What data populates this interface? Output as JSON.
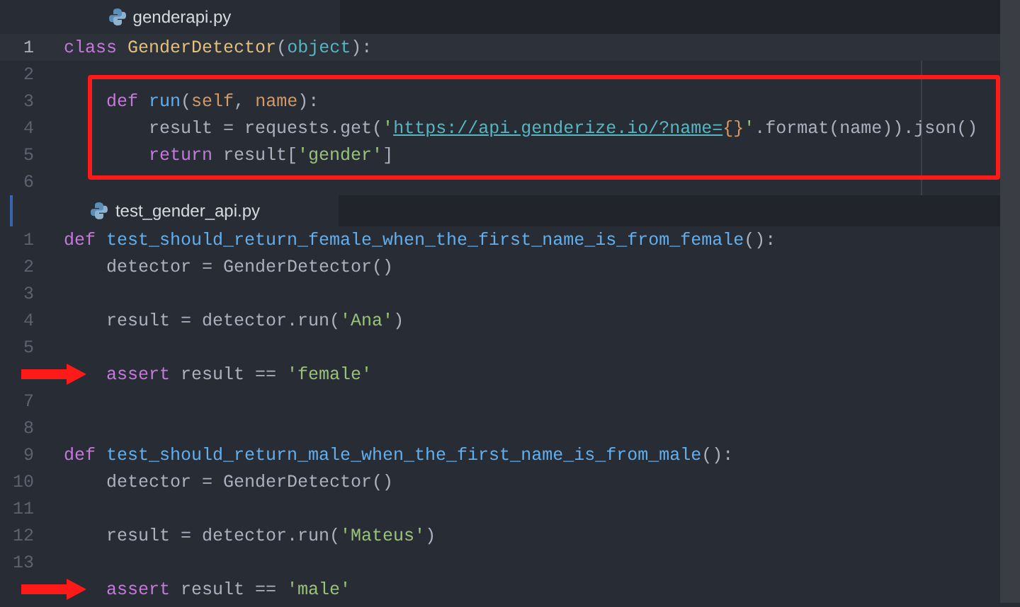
{
  "panes": [
    {
      "tab": {
        "filename": "genderapi.py"
      },
      "lines": [
        {
          "number": "1",
          "active": true,
          "tokens": [
            {
              "kind": "keyword",
              "text": "class "
            },
            {
              "kind": "class",
              "text": "GenderDetector"
            },
            {
              "kind": "plain",
              "text": "("
            },
            {
              "kind": "builtin",
              "text": "object"
            },
            {
              "kind": "plain",
              "text": "):"
            }
          ]
        },
        {
          "number": "2",
          "active": false
        },
        {
          "number": "3",
          "active": false,
          "boxed": true,
          "tokens": [
            {
              "kind": "keyword",
              "text": "    def "
            },
            {
              "kind": "function",
              "text": "run"
            },
            {
              "kind": "plain",
              "text": "("
            },
            {
              "kind": "param",
              "text": "self"
            },
            {
              "kind": "plain",
              "text": ", "
            },
            {
              "kind": "param",
              "text": "name"
            },
            {
              "kind": "plain",
              "text": "):"
            }
          ]
        },
        {
          "number": "4",
          "active": false,
          "boxed": true,
          "tokens": [
            {
              "kind": "plain",
              "text": "        result = requests.get("
            },
            {
              "kind": "string",
              "text": "'"
            },
            {
              "kind": "url",
              "text": "https://api.genderize.io/?name="
            },
            {
              "kind": "brace",
              "text": "{}"
            },
            {
              "kind": "string",
              "text": "'"
            },
            {
              "kind": "plain",
              "text": ".format(name)).json()"
            }
          ]
        },
        {
          "number": "5",
          "active": false,
          "boxed": true,
          "tokens": [
            {
              "kind": "keyword",
              "text": "        return"
            },
            {
              "kind": "plain",
              "text": " result["
            },
            {
              "kind": "string",
              "text": "'gender'"
            },
            {
              "kind": "plain",
              "text": "]"
            }
          ]
        },
        {
          "number": "6",
          "active": false
        }
      ]
    },
    {
      "tab": {
        "filename": "test_gender_api.py"
      },
      "lines": [
        {
          "number": "1",
          "active": false,
          "tokens": [
            {
              "kind": "keyword",
              "text": "def "
            },
            {
              "kind": "function",
              "text": "test_should_return_female_when_the_first_name_is_from_female"
            },
            {
              "kind": "plain",
              "text": "():"
            }
          ]
        },
        {
          "number": "2",
          "active": false,
          "tokens": [
            {
              "kind": "plain",
              "text": "    detector = GenderDetector()"
            }
          ]
        },
        {
          "number": "3",
          "active": false
        },
        {
          "number": "4",
          "active": false,
          "tokens": [
            {
              "kind": "plain",
              "text": "    result = detector.run("
            },
            {
              "kind": "string",
              "text": "'Ana'"
            },
            {
              "kind": "plain",
              "text": ")"
            }
          ]
        },
        {
          "number": "5",
          "active": false
        },
        {
          "active": false,
          "arrow": true,
          "tokens": [
            {
              "kind": "keyword",
              "text": "    assert"
            },
            {
              "kind": "plain",
              "text": " result == "
            },
            {
              "kind": "string",
              "text": "'female'"
            }
          ]
        },
        {
          "number": "7",
          "active": false
        },
        {
          "number": "8",
          "active": false
        },
        {
          "number": "9",
          "active": false,
          "tokens": [
            {
              "kind": "keyword",
              "text": "def "
            },
            {
              "kind": "function",
              "text": "test_should_return_male_when_the_first_name_is_from_male"
            },
            {
              "kind": "plain",
              "text": "():"
            }
          ]
        },
        {
          "number": "10",
          "active": false,
          "tokens": [
            {
              "kind": "plain",
              "text": "    detector = GenderDetector()"
            }
          ]
        },
        {
          "number": "11",
          "active": false
        },
        {
          "number": "12",
          "active": false,
          "tokens": [
            {
              "kind": "plain",
              "text": "    result = detector.run("
            },
            {
              "kind": "string",
              "text": "'Mateus'"
            },
            {
              "kind": "plain",
              "text": ")"
            }
          ]
        },
        {
          "number": "13",
          "active": false
        },
        {
          "active": false,
          "arrow": true,
          "tokens": [
            {
              "kind": "keyword",
              "text": "    assert"
            },
            {
              "kind": "plain",
              "text": " result == "
            },
            {
              "kind": "string",
              "text": "'male'"
            }
          ]
        }
      ]
    }
  ]
}
